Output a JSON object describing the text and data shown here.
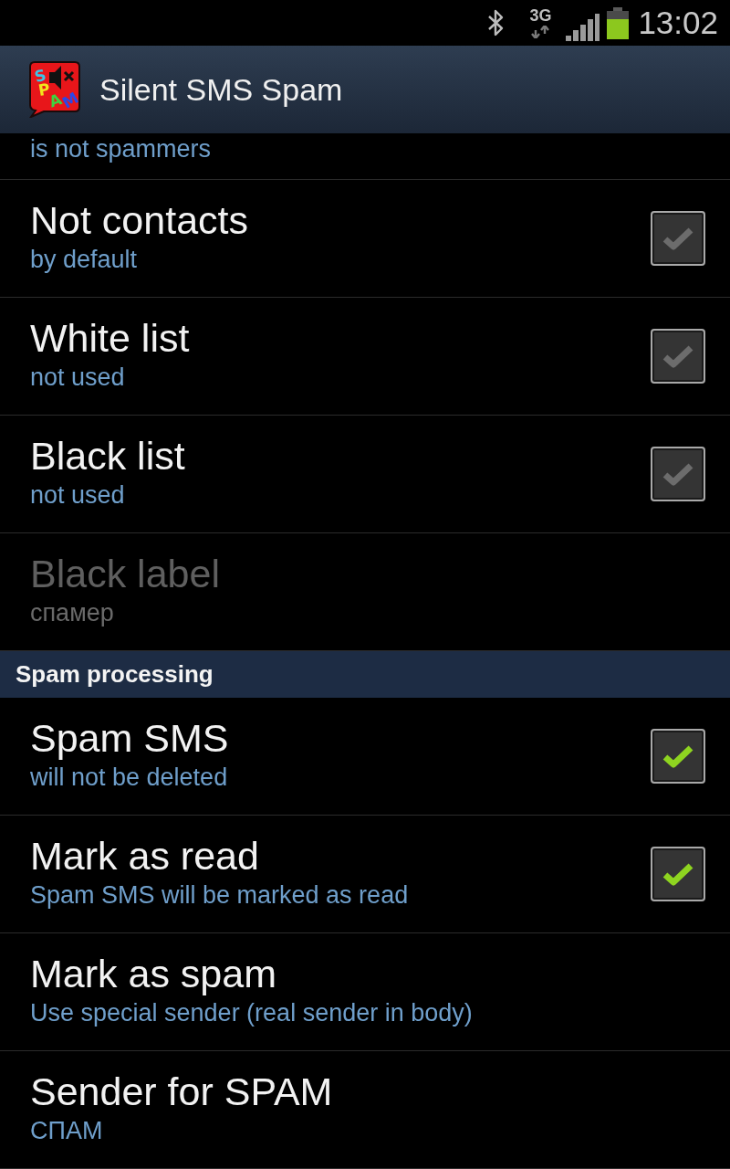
{
  "status_bar": {
    "network": "3G",
    "time": "13:02"
  },
  "action_bar": {
    "logo_text": "SPAM",
    "title": "Silent SMS Spam"
  },
  "items": [
    {
      "kind": "partial",
      "summary": "is not spammers"
    },
    {
      "kind": "checkbox",
      "title": "Not contacts",
      "summary": "by default",
      "checked": false,
      "disabled": false
    },
    {
      "kind": "checkbox",
      "title": "White list",
      "summary": "not used",
      "checked": false,
      "disabled": false
    },
    {
      "kind": "checkbox",
      "title": "Black list",
      "summary": "not used",
      "checked": false,
      "disabled": false
    },
    {
      "kind": "plain",
      "title": "Black label",
      "summary": "спамер",
      "disabled": true
    },
    {
      "kind": "category",
      "title": "Spam processing"
    },
    {
      "kind": "checkbox",
      "title": "Spam SMS",
      "summary": "will not be deleted",
      "checked": true,
      "disabled": false
    },
    {
      "kind": "checkbox",
      "title": "Mark as read",
      "summary": "Spam SMS will be marked as read",
      "checked": true,
      "disabled": false
    },
    {
      "kind": "plain",
      "title": "Mark as spam",
      "summary": "Use special sender (real sender in body)",
      "disabled": false
    },
    {
      "kind": "plain",
      "title": "Sender for SPAM",
      "summary": "СПАМ",
      "disabled": false
    }
  ]
}
